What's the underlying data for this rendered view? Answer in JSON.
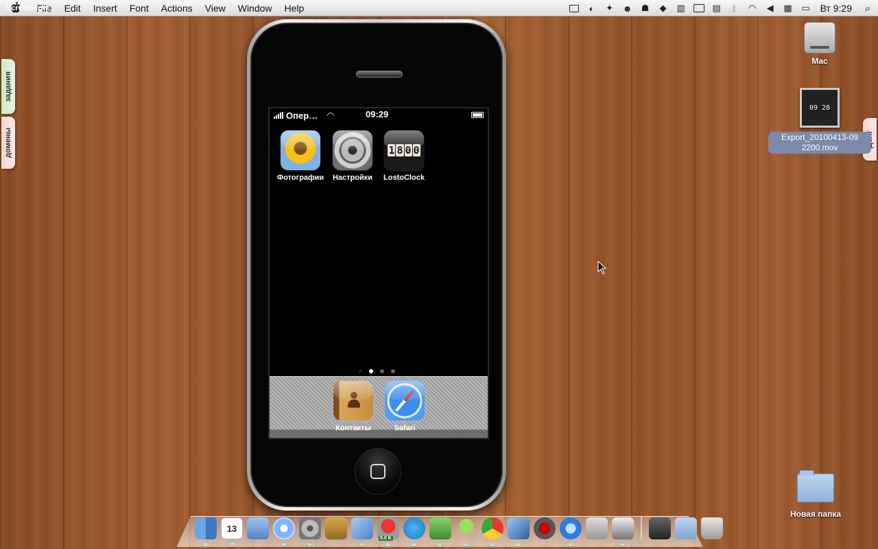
{
  "menubar": {
    "app_name": "ScreenFlow",
    "menus": [
      "File",
      "Edit",
      "Insert",
      "Font",
      "Actions",
      "View",
      "Window",
      "Help"
    ],
    "status_icons": [
      "screenflow-record-icon",
      "sync-icon",
      "network-icon",
      "monitor-icon",
      "skype-icon",
      "dropbox-icon",
      "mirror-icon",
      "display-icon",
      "keyboard-icon",
      "bluetooth-icon",
      "wifi-icon",
      "volume-icon",
      "flag-icon",
      "battery-icon"
    ],
    "clock": "Вт 9:29"
  },
  "side_tabs": {
    "left_top": "задания",
    "left_bottom": "домены",
    "right": "Долг"
  },
  "desktop": {
    "drive_label": "Mac",
    "movie_thumb_text": "09 28",
    "movie_label_line1": "Export_20100413-09",
    "movie_label_line2": "2200.mov",
    "folder_label": "Новая папка"
  },
  "iphone": {
    "carrier": "Опер…",
    "time": "09:29",
    "apps": [
      {
        "label": "Фотографии",
        "icon": "photos-icon"
      },
      {
        "label": "Настройки",
        "icon": "settings-icon"
      },
      {
        "label": "LostoClock",
        "icon": "lostoclock-icon",
        "digits": [
          "1",
          "8",
          "0",
          "0"
        ]
      }
    ],
    "dock_apps": [
      {
        "label": "Контакты",
        "icon": "contacts-icon"
      },
      {
        "label": "Safari",
        "icon": "safari-icon"
      }
    ],
    "pages": 3,
    "active_page": 1
  },
  "dock": {
    "items": [
      "finder-icon",
      "ical-icon",
      "preview-icon",
      "itunes-icon",
      "system-preferences-icon",
      "archive-utility-icon",
      "xcode-icon",
      "transmission-icon",
      "skype-icon",
      "evernote-icon",
      "adium-icon",
      "chrome-icon",
      "iphone-simulator-icon",
      "dvd-player-icon",
      "quicktime-icon",
      "installer-icon",
      "screenflow-icon",
      "photo-folder-icon",
      "applications-folder-icon",
      "trash-icon"
    ],
    "calendar_day": "13",
    "transmission_badge": "5.0 K"
  }
}
